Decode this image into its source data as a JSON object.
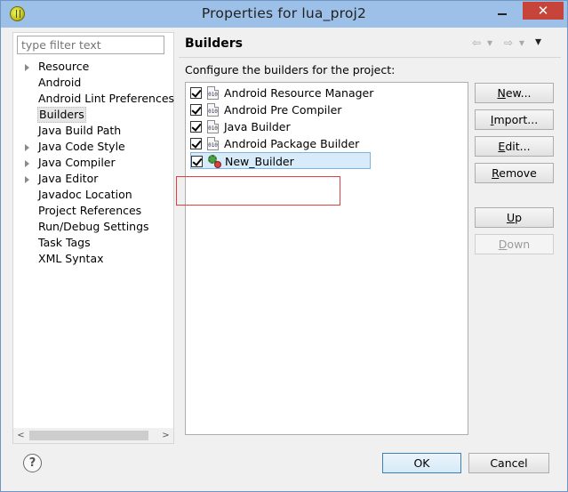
{
  "window": {
    "title": "Properties for lua_proj2",
    "close_glyph": "✕"
  },
  "left_pane": {
    "filter_placeholder": "type filter text",
    "tree": [
      {
        "label": "Resource",
        "expandable": true,
        "selected": false
      },
      {
        "label": "Android",
        "expandable": false,
        "selected": false
      },
      {
        "label": "Android Lint Preferences",
        "expandable": false,
        "selected": false
      },
      {
        "label": "Builders",
        "expandable": false,
        "selected": true
      },
      {
        "label": "Java Build Path",
        "expandable": false,
        "selected": false
      },
      {
        "label": "Java Code Style",
        "expandable": true,
        "selected": false
      },
      {
        "label": "Java Compiler",
        "expandable": true,
        "selected": false
      },
      {
        "label": "Java Editor",
        "expandable": true,
        "selected": false
      },
      {
        "label": "Javadoc Location",
        "expandable": false,
        "selected": false
      },
      {
        "label": "Project References",
        "expandable": false,
        "selected": false
      },
      {
        "label": "Run/Debug Settings",
        "expandable": false,
        "selected": false
      },
      {
        "label": "Task Tags",
        "expandable": false,
        "selected": false
      },
      {
        "label": "XML Syntax",
        "expandable": false,
        "selected": false
      }
    ],
    "scroll_left_glyph": "<",
    "scroll_right_glyph": ">"
  },
  "right_pane": {
    "title": "Builders",
    "nav": {
      "back": "⇦",
      "back_menu": "▾",
      "forward": "⇨",
      "forward_menu": "▾",
      "view_menu": "▾"
    },
    "configure_label": "Configure the builders for the project:",
    "builders": [
      {
        "name": "Android Resource Manager",
        "checked": true,
        "icon": "binary-file-icon",
        "icon_text": "010"
      },
      {
        "name": "Android Pre Compiler",
        "checked": true,
        "icon": "binary-file-icon",
        "icon_text": "010"
      },
      {
        "name": "Java Builder",
        "checked": true,
        "icon": "binary-file-icon",
        "icon_text": "010"
      },
      {
        "name": "Android Package Builder",
        "checked": true,
        "icon": "binary-file-icon",
        "icon_text": "010"
      },
      {
        "name": "New_Builder",
        "checked": true,
        "icon": "external-tool-builder-icon",
        "highlighted": true
      }
    ],
    "buttons": {
      "new": {
        "mnemonic": "N",
        "rest": "ew..."
      },
      "import": {
        "mnemonic": "I",
        "rest": "mport..."
      },
      "edit": {
        "mnemonic": "E",
        "rest": "dit..."
      },
      "remove": {
        "mnemonic": "R",
        "rest": "emove"
      },
      "up": {
        "mnemonic": "U",
        "rest": "p"
      },
      "down": {
        "mnemonic": "D",
        "rest": "own"
      }
    }
  },
  "footer": {
    "help_glyph": "?",
    "ok_label": "OK",
    "cancel_label": "Cancel"
  },
  "colors": {
    "titlebar": "#9cc0e8",
    "close_button": "#c7443a",
    "annotation_box": "#e04040",
    "selection_highlight": "#d7ebfa"
  }
}
